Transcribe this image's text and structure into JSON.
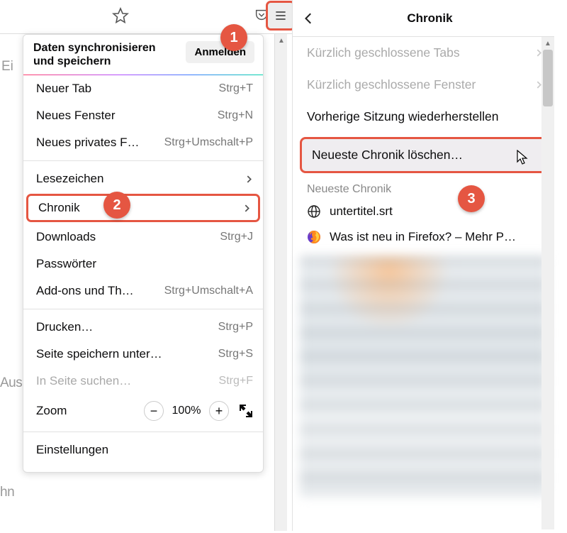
{
  "callouts": {
    "one": "1",
    "two": "2",
    "three": "3"
  },
  "background_labels": {
    "ei": "Ei",
    "aus": "Aus",
    "hn": "hn"
  },
  "menu": {
    "sync_label": "Daten synchronisieren und speichern",
    "sign_in": "Anmelden",
    "items": {
      "new_tab": {
        "label": "Neuer Tab",
        "shortcut": "Strg+T"
      },
      "new_window": {
        "label": "Neues Fenster",
        "shortcut": "Strg+N"
      },
      "new_private": {
        "label": "Neues privates F…",
        "shortcut": "Strg+Umschalt+P"
      },
      "bookmarks": {
        "label": "Lesezeichen"
      },
      "history": {
        "label": "Chronik"
      },
      "downloads": {
        "label": "Downloads",
        "shortcut": "Strg+J"
      },
      "passwords": {
        "label": "Passwörter"
      },
      "addons": {
        "label": "Add-ons und Th…",
        "shortcut": "Strg+Umschalt+A"
      },
      "print": {
        "label": "Drucken…",
        "shortcut": "Strg+P"
      },
      "save_page": {
        "label": "Seite speichern unter…",
        "shortcut": "Strg+S"
      },
      "find": {
        "label": "In Seite suchen…",
        "shortcut": "Strg+F"
      },
      "zoom": {
        "label": "Zoom",
        "value": "100%"
      },
      "settings": {
        "label": "Einstellungen"
      }
    }
  },
  "history_panel": {
    "title": "Chronik",
    "recently_closed_tabs": "Kürzlich geschlossene Tabs",
    "recently_closed_windows": "Kürzlich geschlossene Fenster",
    "restore_session": "Vorherige Sitzung wiederherstellen",
    "clear_recent": "Neueste Chronik löschen…",
    "section_label": "Neueste Chronik",
    "entries": [
      {
        "icon": "globe",
        "label": "untertitel.srt"
      },
      {
        "icon": "firefox",
        "label": "Was ist neu in Firefox? – Mehr P…"
      }
    ]
  }
}
